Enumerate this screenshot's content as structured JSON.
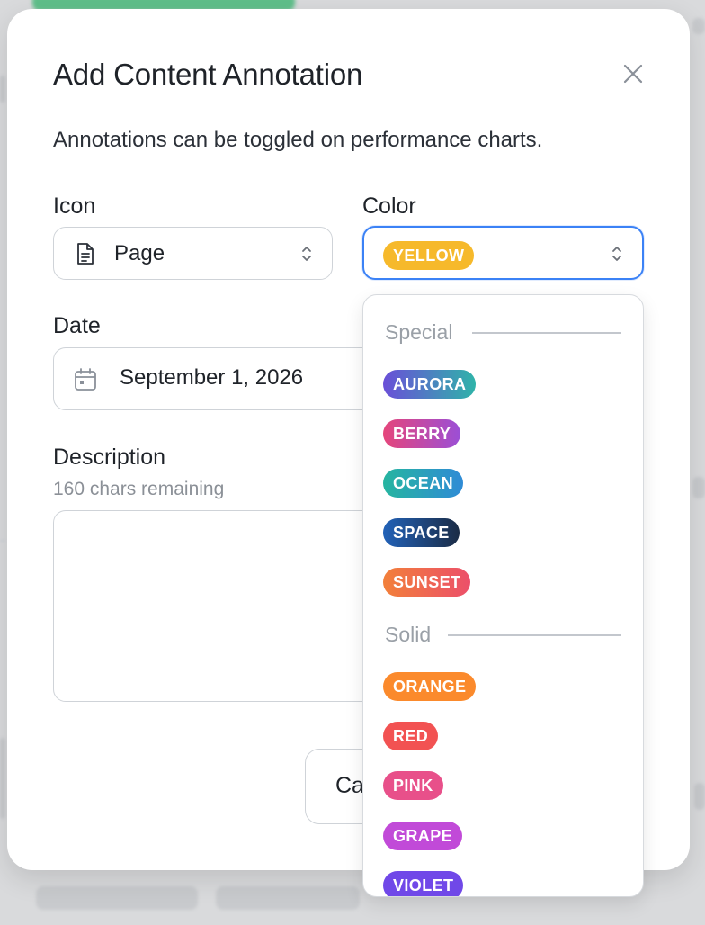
{
  "modal": {
    "title": "Add Content Annotation",
    "subtitle": "Annotations can be toggled on performance charts."
  },
  "icon_field": {
    "label": "Icon",
    "value": "Page",
    "icon": "page-icon"
  },
  "color_field": {
    "label": "Color",
    "value": "YELLOW",
    "value_color": "#f6b92b"
  },
  "date_field": {
    "label": "Date",
    "value": "September 1, 2026",
    "icon": "calendar-icon"
  },
  "description_field": {
    "label": "Description",
    "hint": "160 chars remaining",
    "value": ""
  },
  "buttons": {
    "cancel_partial": "Ca"
  },
  "dropdown": {
    "groups": [
      {
        "heading": "Special",
        "options": [
          {
            "label": "AURORA",
            "color": "linear-gradient(90deg,#6a4fd8,#2fb3a9)"
          },
          {
            "label": "BERRY",
            "color": "linear-gradient(90deg,#e5467b,#9b4fd6)"
          },
          {
            "label": "OCEAN",
            "color": "linear-gradient(90deg,#26b5a0,#2f8bd6)"
          },
          {
            "label": "SPACE",
            "color": "linear-gradient(90deg,#2262b8,#1b2c46)"
          },
          {
            "label": "SUNSET",
            "color": "linear-gradient(90deg,#f2803a,#ec4f6a)"
          }
        ]
      },
      {
        "heading": "Solid",
        "options": [
          {
            "label": "ORANGE",
            "color": "#fb8a2c"
          },
          {
            "label": "RED",
            "color": "#f25252"
          },
          {
            "label": "PINK",
            "color": "#e8508a"
          },
          {
            "label": "GRAPE",
            "color": "#c14ad8"
          },
          {
            "label": "VIOLET",
            "color": "#7048e8"
          }
        ]
      }
    ]
  }
}
